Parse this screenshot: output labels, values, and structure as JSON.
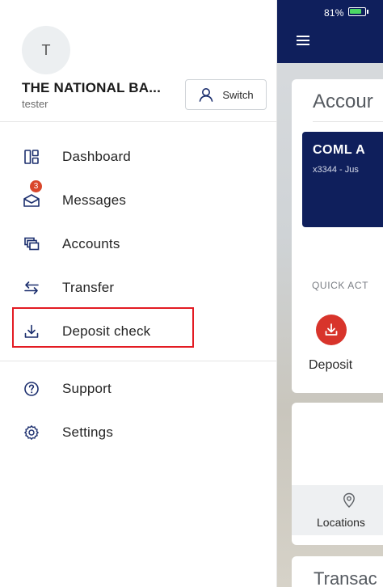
{
  "status_bar": {
    "battery": "81%"
  },
  "background_app": {
    "card_title": "Accour",
    "account_name": "COML A",
    "account_sub": "x3344 - Jus",
    "quick_actions_label": "QUICK ACT",
    "deposit_label": "Deposit",
    "locations_label": "Locations",
    "transactions_title": "Transac"
  },
  "drawer": {
    "avatar_initial": "T",
    "bank_name": "THE NATIONAL BA...",
    "user": "tester",
    "switch_label": "Switch",
    "items": [
      {
        "label": "Dashboard",
        "icon": "dashboard-icon"
      },
      {
        "label": "Messages",
        "icon": "messages-icon",
        "badge": "3"
      },
      {
        "label": "Accounts",
        "icon": "accounts-icon"
      },
      {
        "label": "Transfer",
        "icon": "transfer-icon"
      },
      {
        "label": "Deposit check",
        "icon": "deposit-check-icon"
      }
    ],
    "secondary_items": [
      {
        "label": "Support",
        "icon": "help-icon"
      },
      {
        "label": "Settings",
        "icon": "gear-icon"
      }
    ]
  },
  "colors": {
    "header": "#0f1f5c",
    "accent_red": "#d8342b",
    "highlight": "#e31b23",
    "icon_blue": "#1c2f6e"
  }
}
